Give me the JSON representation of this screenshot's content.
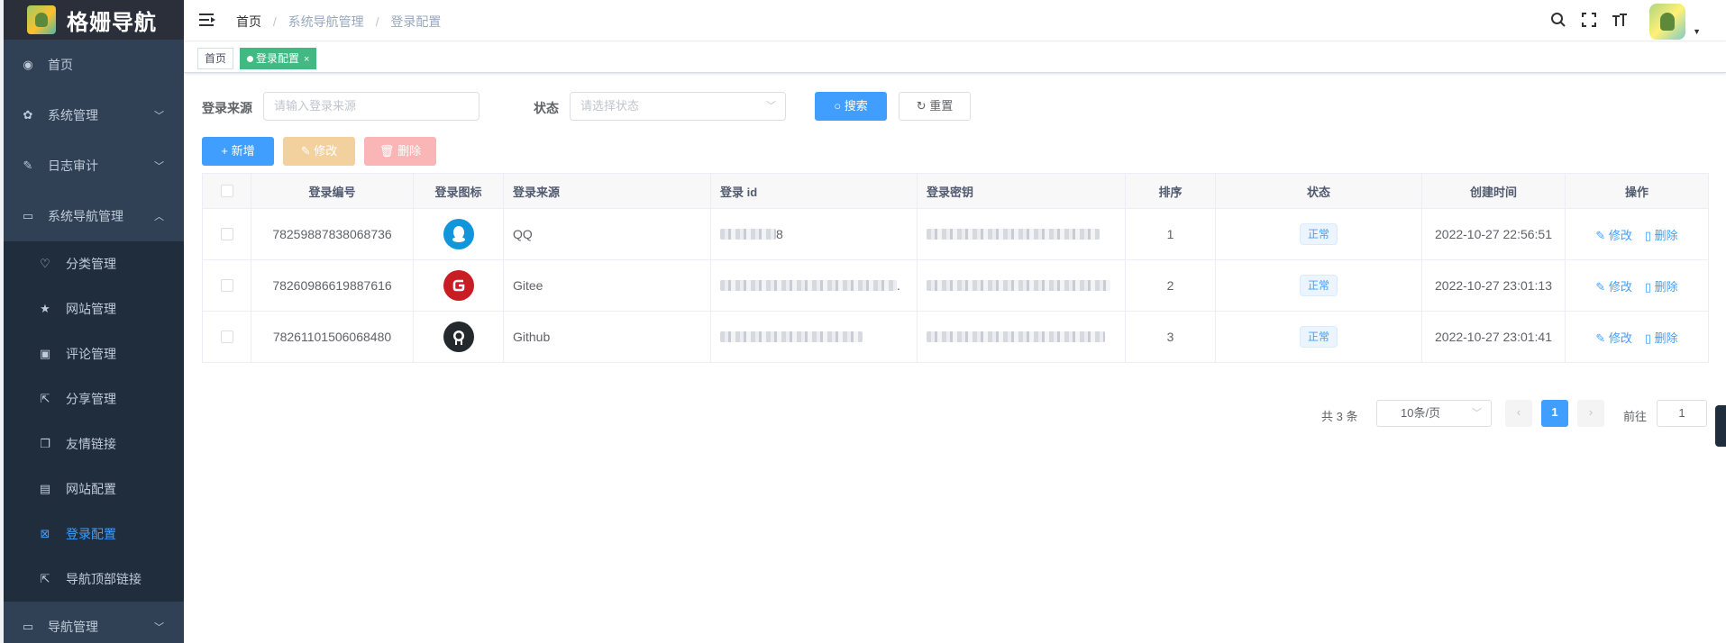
{
  "app": {
    "title": "格姗导航"
  },
  "sidebar": {
    "items": [
      {
        "label": "首页",
        "icon": "dashboard-icon"
      },
      {
        "label": "系统管理",
        "icon": "gear-icon"
      },
      {
        "label": "日志审计",
        "icon": "edit-icon"
      },
      {
        "label": "系统导航管理",
        "icon": "monitor-icon"
      }
    ],
    "subitems": [
      {
        "label": "分类管理",
        "icon": "shield-icon"
      },
      {
        "label": "网站管理",
        "icon": "star-icon"
      },
      {
        "label": "评论管理",
        "icon": "comment-icon"
      },
      {
        "label": "分享管理",
        "icon": "share-icon"
      },
      {
        "label": "友情链接",
        "icon": "copy-icon"
      },
      {
        "label": "网站配置",
        "icon": "config-icon"
      },
      {
        "label": "登录配置",
        "icon": "login-icon"
      },
      {
        "label": "导航顶部链接",
        "icon": "link-icon"
      }
    ],
    "bottom_item": {
      "label": "导航管理",
      "icon": "monitor-icon"
    }
  },
  "breadcrumb": [
    "首页",
    "系统导航管理",
    "登录配置"
  ],
  "tags": {
    "home": "首页",
    "current": "登录配置",
    "close": "×"
  },
  "search": {
    "source_label": "登录来源",
    "source_placeholder": "请输入登录来源",
    "status_label": "状态",
    "status_placeholder": "请选择状态",
    "search_button": "搜索",
    "reset_button": "重置"
  },
  "toolbar": {
    "add": "新增",
    "edit": "修改",
    "delete": "删除"
  },
  "table": {
    "headers": [
      "登录编号",
      "登录图标",
      "登录来源",
      "登录 id",
      "登录密钥",
      "排序",
      "状态",
      "创建时间",
      "操作"
    ],
    "rows": [
      {
        "id": "78259887838068736",
        "source": "QQ",
        "login_id_tail": "8",
        "sort": "1",
        "status": "正常",
        "created": "2022-10-27 22:56:51",
        "icon_color": "#1296db",
        "icon_text": "Q"
      },
      {
        "id": "78260986619887616",
        "source": "Gitee",
        "login_id_tail": ".",
        "sort": "2",
        "status": "正常",
        "created": "2022-10-27 23:01:13",
        "icon_color": "#c71d23",
        "icon_text": "G"
      },
      {
        "id": "78261101506068480",
        "source": "Github",
        "login_id_tail": "",
        "sort": "3",
        "status": "正常",
        "created": "2022-10-27 23:01:41",
        "icon_color": "#24292e",
        "icon_text": "●"
      }
    ],
    "op_edit": "修改",
    "op_delete": "删除"
  },
  "pagination": {
    "total": "共 3 条",
    "page_size": "10条/页",
    "current": "1",
    "goto_label": "前往",
    "goto_value": "1"
  },
  "colors": {
    "primary": "#409eff",
    "sidebar_bg": "#304156",
    "tag_active": "#42b983"
  }
}
